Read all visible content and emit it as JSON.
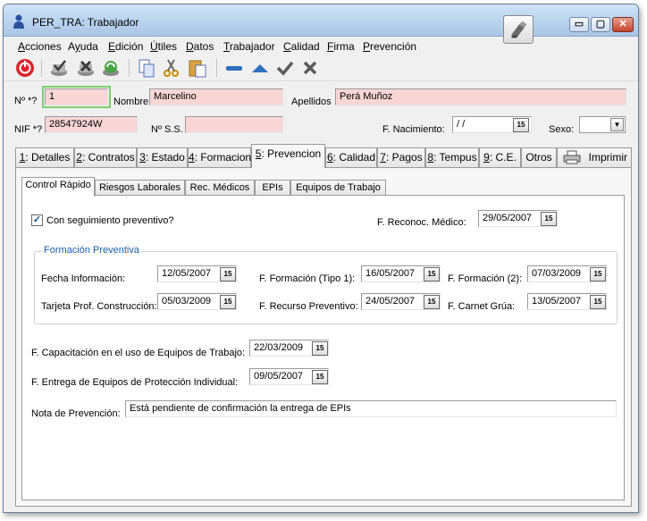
{
  "window": {
    "title": "PER_TRA: Trabajador",
    "controls": {
      "minimize": "▭",
      "maximize": "▢",
      "close": "✕"
    }
  },
  "menu": [
    {
      "pre": "",
      "u": "A",
      "post": "cciones"
    },
    {
      "pre": "A",
      "u": "y",
      "post": "uda"
    },
    {
      "pre": "",
      "u": "E",
      "post": "dición"
    },
    {
      "pre": "",
      "u": "Ú",
      "post": "tiles"
    },
    {
      "pre": "",
      "u": "D",
      "post": "atos"
    },
    {
      "pre": "",
      "u": "T",
      "post": "rabajador"
    },
    {
      "pre": "",
      "u": "C",
      "post": "alidad"
    },
    {
      "pre": "",
      "u": "F",
      "post": "irma"
    },
    {
      "pre": "",
      "u": "P",
      "post": "revención"
    }
  ],
  "toolbar": {
    "icons": [
      "power-icon",
      "check-all-icon",
      "delete-all-icon",
      "refresh-icon",
      "copy-icon",
      "cut-icon",
      "paste-icon",
      "minus-icon",
      "up-icon",
      "accept-icon",
      "cancel-icon"
    ]
  },
  "header": {
    "num_label": "Nº *?",
    "num_value": "1",
    "nombre_label": "Nombre",
    "nombre_value": "Marcelino",
    "apellidos_label": "Apellidos",
    "apellidos_value": "Perá Muñoz",
    "nif_label": "NIF *?",
    "nif_value": "28547924W",
    "nss_label": "Nº S.S.",
    "nss_value": "",
    "fnac_label": "F. Nacimiento:",
    "fnac_value": " / /",
    "sexo_label": "Sexo:",
    "sexo_value": ""
  },
  "tabs": [
    {
      "u": "1",
      "text": ": Detalles",
      "active": false
    },
    {
      "u": "2",
      "text": ": Contratos",
      "active": false
    },
    {
      "u": "3",
      "text": ": Estado",
      "active": false
    },
    {
      "u": "4",
      "text": ": Formacion",
      "active": false
    },
    {
      "u": "5",
      "text": ": Prevencion",
      "active": true
    },
    {
      "u": "6",
      "text": ": Calidad",
      "active": false
    },
    {
      "u": "7",
      "text": ": Pagos",
      "active": false
    },
    {
      "u": "8",
      "text": ": Tempus",
      "active": false
    },
    {
      "u": "9",
      "text": ": C.E.",
      "active": false
    },
    {
      "u": "",
      "text": "Otros",
      "active": false
    },
    {
      "u": "",
      "text": "Imprimir",
      "active": false
    }
  ],
  "subtabs": [
    {
      "label": "Control Rápido",
      "active": true
    },
    {
      "label": "Riesgos Laborales",
      "active": false
    },
    {
      "label": "Rec. Médicos",
      "active": false
    },
    {
      "label": "EPIs",
      "active": false
    },
    {
      "label": "Equipos de Trabajo",
      "active": false
    }
  ],
  "control": {
    "seguimiento_label": "Con seguimiento preventivo?",
    "seguimiento_checked": true,
    "reconoc_label": "F. Reconoc. Médico:",
    "reconoc_value": "29/05/2007",
    "group_title": "Formación Preventiva",
    "fecha_info_label": "Fecha Información:",
    "fecha_info_value": "12/05/2007",
    "form_tipo1_label": "F. Formación (Tipo 1):",
    "form_tipo1_value": "16/05/2007",
    "form2_label": "F. Formación (2):",
    "form2_value": "07/03/2009",
    "tarjeta_label": "Tarjeta Prof. Construcción:",
    "tarjeta_value": "05/03/2009",
    "recurso_label": "F. Recurso Preventivo:",
    "recurso_value": "24/05/2007",
    "carnet_label": "F. Carnet Grúa:",
    "carnet_value": "13/05/2007",
    "capacitacion_label": "F. Capacitación en el uso de Equipos de Trabajo:",
    "capacitacion_value": "22/03/2009",
    "entrega_label": "F. Entrega de Equipos de Protección Individual:",
    "entrega_value": "09/05/2007",
    "nota_label": "Nota de Prevención:",
    "nota_value": "Está pendiente de confirmación la entrega de EPIs",
    "cal_glyph": "15"
  }
}
